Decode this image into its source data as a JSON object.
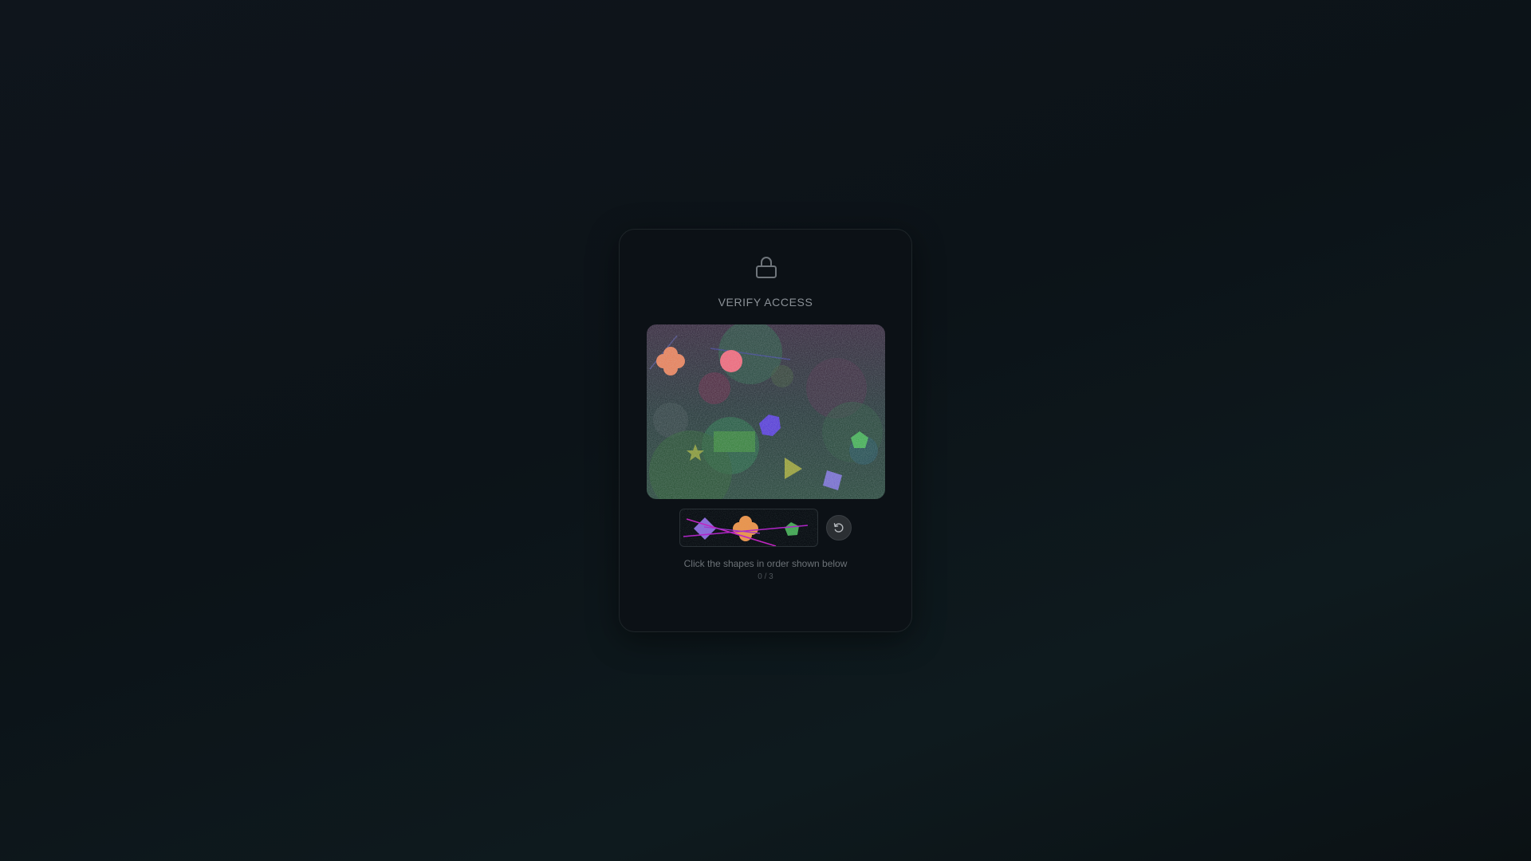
{
  "captcha": {
    "title": "VERIFY ACCESS",
    "lock_icon": "lock-icon",
    "instruction": "Click the shapes in order shown below",
    "progress": "0 / 3",
    "reset_icon": "refresh-icon",
    "target_sequence": [
      "purple-diamond",
      "orange-blob",
      "green-pentagon"
    ],
    "colors": {
      "card_bg": "#0c1116",
      "title": "#8b9197",
      "instruction": "#6c7277"
    }
  }
}
